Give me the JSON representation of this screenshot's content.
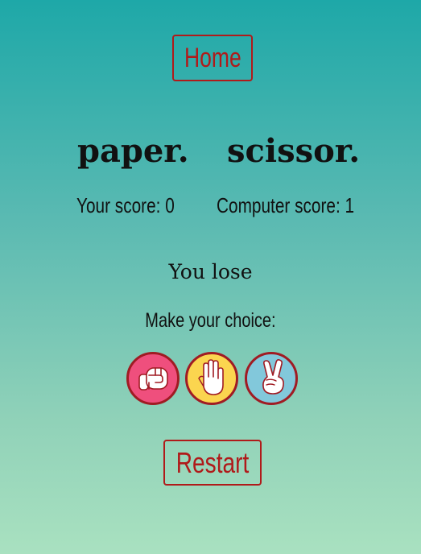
{
  "nav": {
    "home_label": "Home"
  },
  "round": {
    "player_choice": "paper.",
    "computer_choice": "scissor."
  },
  "scores": {
    "player_label": "Your score: 0",
    "computer_label": "Computer score: 1",
    "player_value": 0,
    "computer_value": 1
  },
  "result": "You lose",
  "prompt": "Make your choice:",
  "choices": [
    {
      "name": "rock",
      "icon": "fist-icon",
      "color": "#ef4f7d"
    },
    {
      "name": "paper",
      "icon": "open-hand-icon",
      "color": "#fbd54f"
    },
    {
      "name": "scissors",
      "icon": "peace-hand-icon",
      "color": "#82c8db"
    }
  ],
  "controls": {
    "restart_label": "Restart"
  },
  "colors": {
    "accent": "#b01a1a",
    "background_top": "#1ea8a8",
    "background_bottom": "#a9e1c0"
  }
}
